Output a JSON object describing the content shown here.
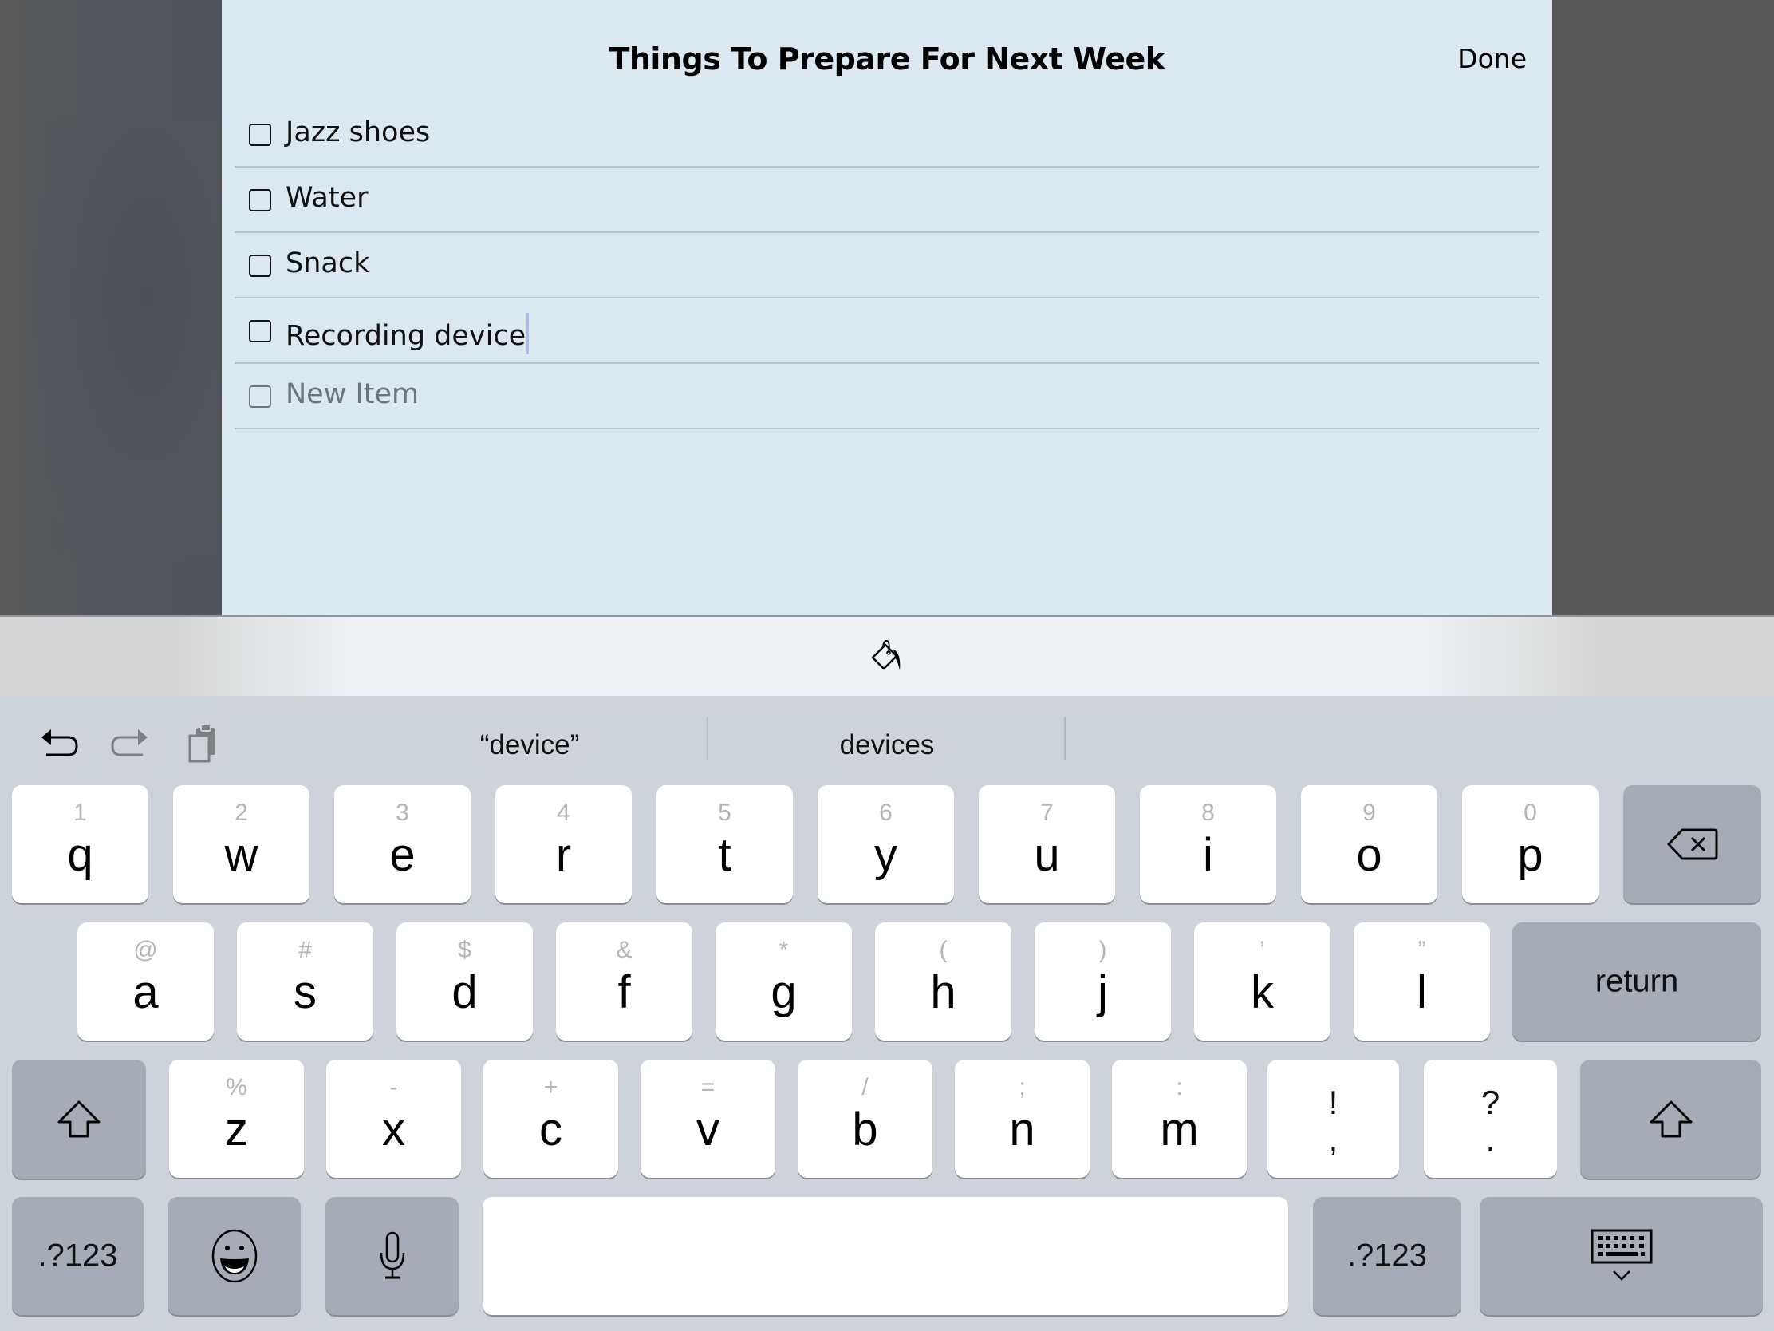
{
  "sheet": {
    "title": "Things To Prepare For Next Week",
    "done_label": "Done",
    "items": [
      {
        "text": "Jazz shoes",
        "checked": false
      },
      {
        "text": "Water",
        "checked": false
      },
      {
        "text": "Snack",
        "checked": false
      },
      {
        "text": "Recording device",
        "checked": false,
        "editing": true
      }
    ],
    "new_item_placeholder": "New Item"
  },
  "accessory": {
    "icon": "paint-bucket-icon"
  },
  "keyboard": {
    "shortcuts": [
      "undo-icon",
      "redo-icon",
      "paste-icon"
    ],
    "predictions": [
      "“device”",
      "devices",
      ""
    ],
    "row1": [
      {
        "alt": "1",
        "main": "q"
      },
      {
        "alt": "2",
        "main": "w"
      },
      {
        "alt": "3",
        "main": "e"
      },
      {
        "alt": "4",
        "main": "r"
      },
      {
        "alt": "5",
        "main": "t"
      },
      {
        "alt": "6",
        "main": "y"
      },
      {
        "alt": "7",
        "main": "u"
      },
      {
        "alt": "8",
        "main": "i"
      },
      {
        "alt": "9",
        "main": "o"
      },
      {
        "alt": "0",
        "main": "p"
      }
    ],
    "row2": [
      {
        "alt": "@",
        "main": "a"
      },
      {
        "alt": "#",
        "main": "s"
      },
      {
        "alt": "$",
        "main": "d"
      },
      {
        "alt": "&",
        "main": "f"
      },
      {
        "alt": "*",
        "main": "g"
      },
      {
        "alt": "(",
        "main": "h"
      },
      {
        "alt": ")",
        "main": "j"
      },
      {
        "alt": "’",
        "main": "k"
      },
      {
        "alt": "”",
        "main": "l"
      }
    ],
    "row3": [
      {
        "alt": "%",
        "main": "z"
      },
      {
        "alt": "-",
        "main": "x"
      },
      {
        "alt": "+",
        "main": "c"
      },
      {
        "alt": "=",
        "main": "v"
      },
      {
        "alt": "/",
        "main": "b"
      },
      {
        "alt": ";",
        "main": "n"
      },
      {
        "alt": ":",
        "main": "m"
      }
    ],
    "punct_keys": [
      {
        "top": "!",
        "bottom": ","
      },
      {
        "top": "?",
        "bottom": "."
      }
    ],
    "return_label": "return",
    "numbers_label": ".?123",
    "space_label": ""
  }
}
